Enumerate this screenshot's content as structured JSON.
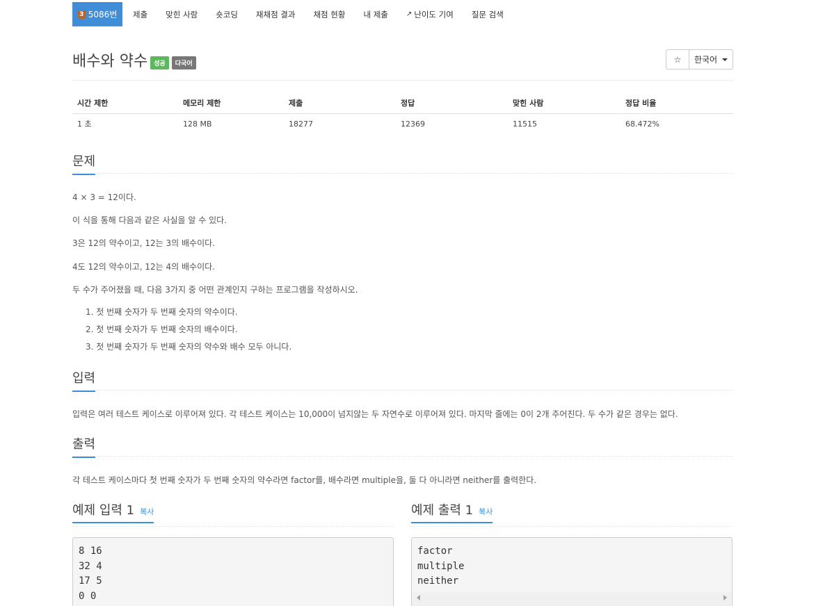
{
  "nav": {
    "problem_tab": "5086번",
    "tier_badge": "3",
    "items": [
      "제출",
      "맞힌 사람",
      "숏코딩",
      "재채점 결과",
      "채점 현황",
      "내 제출",
      "난이도 기여",
      "질문 검색"
    ]
  },
  "problem": {
    "title": "배수와 약수",
    "labels": [
      "성공",
      "다국어"
    ],
    "language": "한국어"
  },
  "stats": {
    "headers": [
      "시간 제한",
      "메모리 제한",
      "제출",
      "정답",
      "맞힌 사람",
      "정답 비율"
    ],
    "values": [
      "1 초",
      "128 MB",
      "18277",
      "12369",
      "11515",
      "68.472%"
    ]
  },
  "sections": {
    "problem": "문제",
    "input": "입력",
    "output": "출력"
  },
  "description": [
    "4 × 3 = 12이다.",
    "이 식을 통해 다음과 같은 사실을 알 수 있다.",
    "3은 12의 약수이고, 12는 3의 배수이다.",
    "4도 12의 약수이고, 12는 4의 배수이다.",
    "두 수가 주어졌을 때, 다음 3가지 중 어떤 관계인지 구하는 프로그램을 작성하시오."
  ],
  "list": [
    "1. 첫 번째 숫자가 두 번째 숫자의 약수이다.",
    "2. 첫 번째 숫자가 두 번째 숫자의 배수이다.",
    "3. 첫 번째 숫자가 두 번째 숫자의 약수와 배수 모두 아니다."
  ],
  "input_text": "입력은 여러 테스트 케이스로 이루어져 있다. 각 테스트 케이스는 10,000이 넘지않는 두 자연수로 이루어져 있다. 마지막 줄에는 0이 2개 주어진다. 두 수가 같은 경우는 없다.",
  "output_text": "각 테스트 케이스마다 첫 번째 숫자가 두 번째 숫자의 약수라면 factor를, 배수라면 multiple을, 둘 다 아니라면 neither를 출력한다.",
  "samples": {
    "input_title": "예제 입력 1",
    "output_title": "예제 출력 1",
    "copy_label": "복사",
    "input_lines": [
      "8 16",
      "32 4",
      "17 5",
      "0 0"
    ],
    "output_lines": [
      "factor",
      "multiple",
      "neither"
    ]
  },
  "icons": [
    "star-icon",
    "caret-down-icon",
    "external-link-icon"
  ]
}
